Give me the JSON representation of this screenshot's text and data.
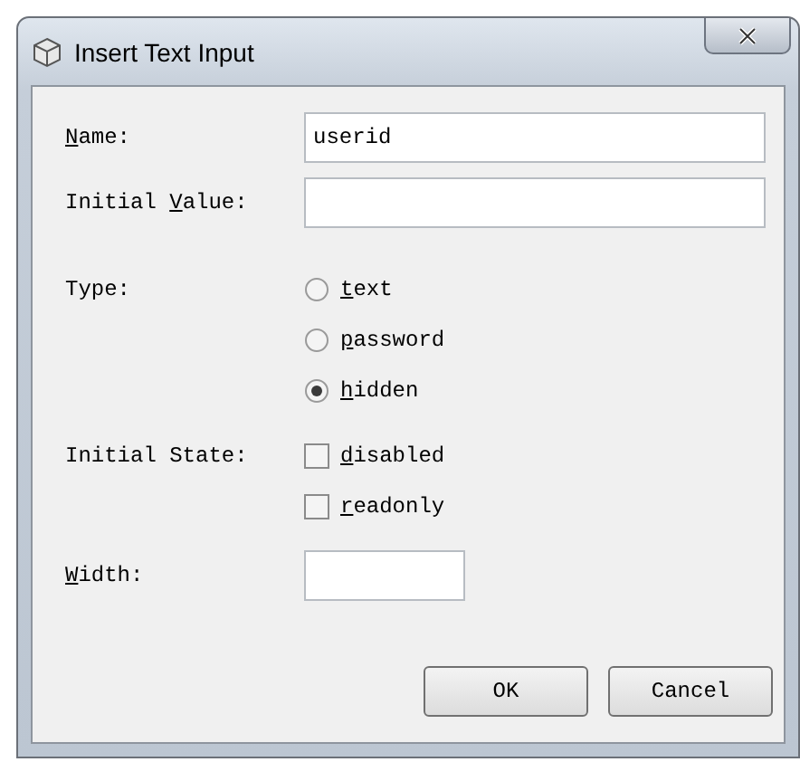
{
  "window": {
    "title": "Insert Text Input"
  },
  "rows": [
    {
      "kind": "text",
      "label": {
        "key": "N",
        "post": "ame:"
      },
      "value": "userid"
    },
    {
      "kind": "text",
      "label": {
        "pre": "Initial ",
        "key": "V",
        "post": "alue:"
      }
    },
    {
      "kind": "radio",
      "label": {
        "pre": "Type:"
      },
      "options": [
        {
          "label": {
            "key": "t",
            "post": "ext"
          },
          "selected": false
        },
        {
          "label": {
            "key": "p",
            "post": "assword"
          },
          "selected": false
        },
        {
          "label": {
            "key": "h",
            "post": "idden"
          },
          "selected": true
        }
      ]
    },
    {
      "kind": "checkbox",
      "label": {
        "pre": "Initial State:"
      },
      "options": [
        {
          "label": {
            "key": "d",
            "post": "isabled"
          },
          "checked": false
        },
        {
          "label": {
            "key": "r",
            "post": "eadonly"
          },
          "checked": false
        }
      ]
    },
    {
      "kind": "small_text",
      "label": {
        "key": "W",
        "post": "idth:"
      }
    }
  ],
  "buttons": [
    {
      "label": "OK"
    },
    {
      "label": "Cancel"
    }
  ]
}
